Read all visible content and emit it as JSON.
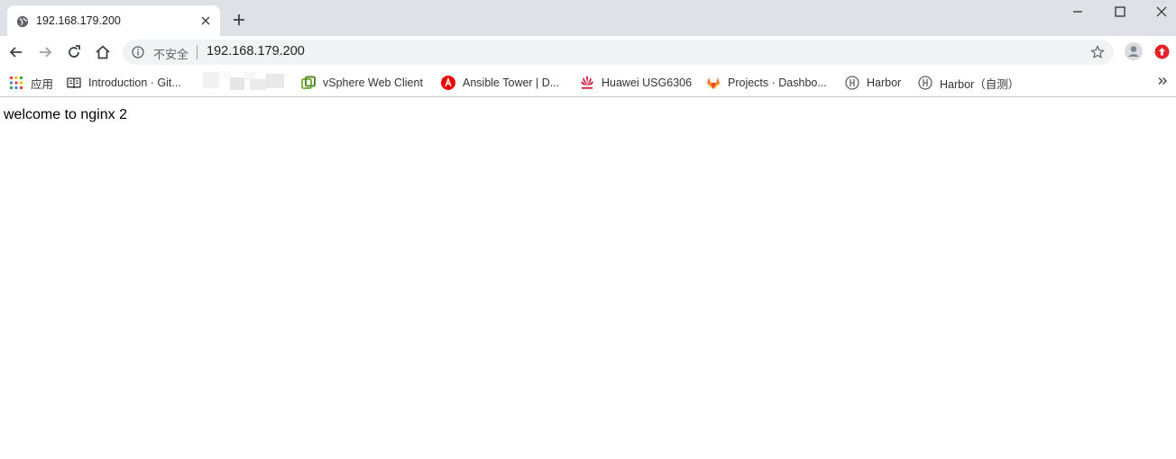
{
  "browser": {
    "tab": {
      "title": "192.168.179.200",
      "favicon": "globe-icon"
    },
    "new_tab_icon": "plus-icon",
    "window_controls": [
      "minimize-icon",
      "maximize-icon",
      "close-icon"
    ],
    "toolbar": {
      "back_icon": "arrow-left-icon",
      "forward_icon": "arrow-right-icon",
      "reload_icon": "reload-icon",
      "home_icon": "home-icon"
    },
    "omnibox": {
      "security_label": "不安全",
      "url": "192.168.179.200",
      "bookmark_icon": "star-icon"
    },
    "profile_icon": "avatar-icon",
    "extension_icon": "extension-red-icon"
  },
  "bookmarks": [
    {
      "label": "应用",
      "icon": "apps-grid-icon"
    },
    {
      "label": "Introduction · Git...",
      "icon": "book-icon"
    },
    {
      "label": "vSphere Web Client",
      "icon": "vsphere-icon"
    },
    {
      "label": "Ansible Tower | D...",
      "icon": "ansible-icon"
    },
    {
      "label": "Huawei USG6306",
      "icon": "huawei-icon"
    },
    {
      "label": "Projects · Dashbo...",
      "icon": "gitlab-icon"
    },
    {
      "label": "Harbor",
      "icon": "harbor-icon"
    },
    {
      "label": "Harbor（自测）",
      "icon": "harbor-icon"
    }
  ],
  "page": {
    "text": "welcome to nginx 2"
  },
  "colors": {
    "tabstrip": "#dee1e6",
    "omnibox": "#f1f3f4",
    "extension": "#e8222b",
    "ansible": "#ee0000",
    "gitlab": "#fc6d26"
  }
}
